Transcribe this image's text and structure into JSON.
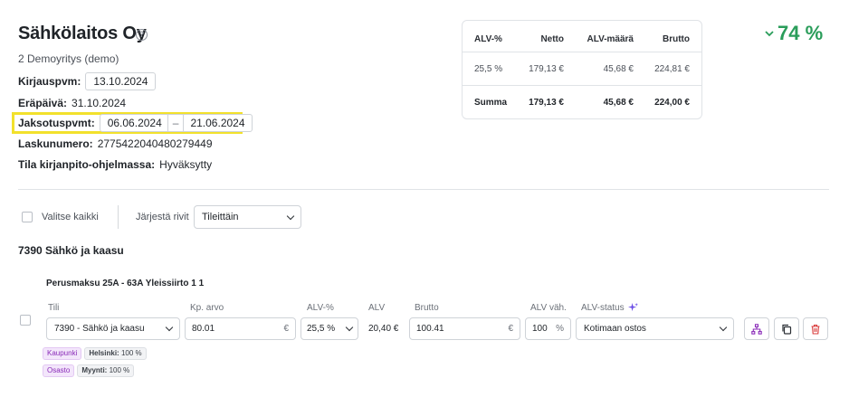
{
  "company": {
    "name": "Sähkölaitos Oy",
    "subtitle": "2 Demoyritys (demo)"
  },
  "fields": {
    "booking_date_label": "Kirjauspvm:",
    "booking_date": "13.10.2024",
    "due_date_label": "Eräpäivä:",
    "due_date": "31.10.2024",
    "period_label": "Jaksotuspvmt:",
    "period_start": "06.06.2024",
    "period_sep": "–",
    "period_end": "21.06.2024",
    "invoice_number_label": "Laskunumero:",
    "invoice_number": "2775422040480279449",
    "status_label": "Tila kirjanpito-ohjelmassa:",
    "status": "Hyväksytty"
  },
  "vat_table": {
    "headers": [
      "ALV-%",
      "Netto",
      "ALV-määrä",
      "Brutto"
    ],
    "rows": [
      [
        "25,5 %",
        "179,13 €",
        "45,68 €",
        "224,81 €"
      ]
    ],
    "sum": [
      "Summa",
      "179,13 €",
      "45,68 €",
      "224,00 €"
    ]
  },
  "confidence": {
    "value": "74 %",
    "color": "#2a9d5a"
  },
  "toolbar": {
    "select_all": "Valitse kaikki",
    "sort_label": "Järjestä rivit",
    "sort_value": "Tileittäin"
  },
  "account_group": "7390 Sähkö ja kaasu",
  "line": {
    "title": "Perusmaksu 25A - 63A Yleissiirto 1 1",
    "labels": {
      "account": "Tili",
      "amount": "Kp. arvo",
      "vat_pct": "ALV-%",
      "vat": "ALV",
      "gross": "Brutto",
      "vat_deduct": "ALV väh.",
      "vat_status": "ALV-status"
    },
    "account": "7390 - Sähkö ja kaasu",
    "amount": "80.01",
    "amount_unit": "€",
    "vat_pct": "25,5 %",
    "vat": "20,40 €",
    "gross": "100.41",
    "gross_unit": "€",
    "vat_deduct": "100",
    "vat_deduct_unit": "%",
    "vat_status": "Kotimaan ostos",
    "tags": [
      {
        "dimension": "Kaupunki",
        "value_name": "Helsinki:",
        "value_pct": "100 %"
      },
      {
        "dimension": "Osasto",
        "value_name": "Myynti:",
        "value_pct": "100 %"
      }
    ]
  },
  "colors": {
    "highlight": "#f2e12c",
    "tag_purple": "#8a2bb8",
    "delete_red": "#d93a3a",
    "sparkle": "#6b4ee6"
  }
}
